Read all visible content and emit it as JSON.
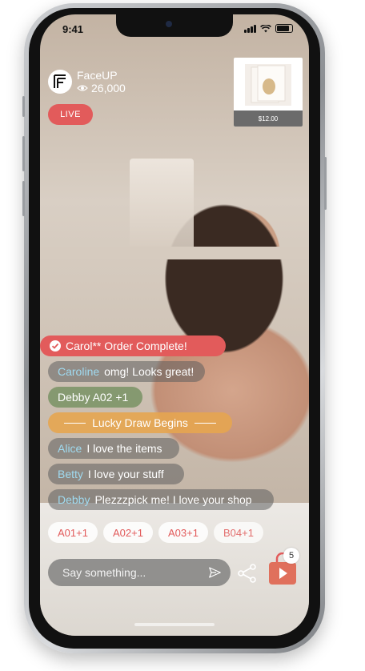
{
  "status_bar": {
    "time": "9:41"
  },
  "channel": {
    "name": "FaceUP",
    "viewers": "26,000",
    "live_label": "LIVE",
    "logo_letter": "F"
  },
  "product": {
    "price": "$12.00"
  },
  "chat": [
    {
      "type": "order",
      "user": "",
      "text": "Carol** Order Complete!"
    },
    {
      "type": "plain",
      "user": "Caroline",
      "text": "omg! Looks great!"
    },
    {
      "type": "green",
      "user": "",
      "text": "Debby A02 +1"
    },
    {
      "type": "lucky",
      "user": "",
      "text": "Lucky Draw Begins"
    },
    {
      "type": "plain",
      "user": "Alice",
      "text": "I love the items"
    },
    {
      "type": "plain",
      "user": "Betty",
      "text": "I love your stuff"
    },
    {
      "type": "plain",
      "user": "Debby",
      "text": "Plezzzpick me! I love your shop"
    }
  ],
  "quick_replies": [
    "A01+1",
    "A02+1",
    "A03+1",
    "B04+1"
  ],
  "composer": {
    "placeholder": "Say something..."
  },
  "cart": {
    "count": "5"
  },
  "colors": {
    "accent": "#e25b5b",
    "lucky": "#e6a550",
    "username": "#9fdaf0"
  },
  "icons": [
    "check-circle-icon",
    "eye-icon",
    "send-icon",
    "share-icon",
    "shopping-bag-icon"
  ]
}
